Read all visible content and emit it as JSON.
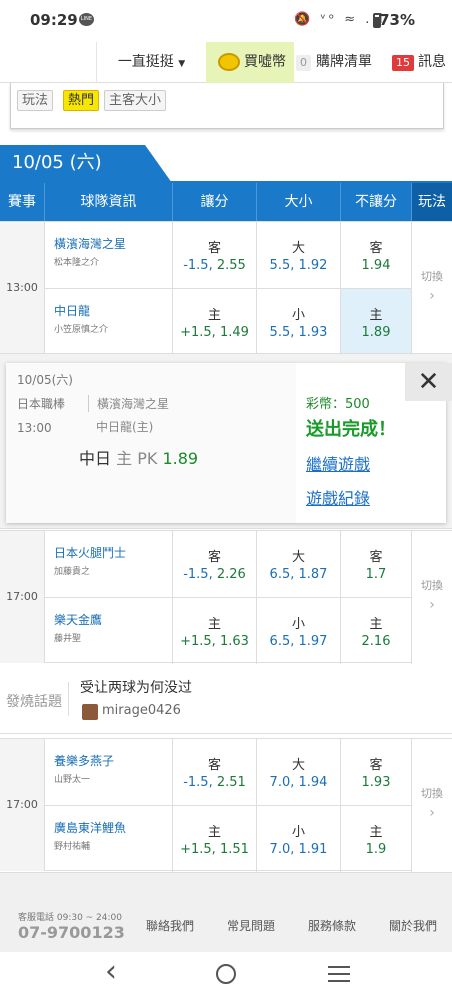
{
  "status": {
    "time": "09:29",
    "battery": "73%",
    "icons": "🔕 ᵛᵒ ≈ .ıl"
  },
  "nav": {
    "dropdown": "一直挺挺",
    "buy": "買噓幣",
    "cart_count": "0",
    "cart": "購牌清單",
    "msg_count": "15",
    "msg": "訊息"
  },
  "filter": {
    "tags": [
      "玩法",
      "熱門",
      "主客大小"
    ]
  },
  "date": "10/05 (六)",
  "header": {
    "event": "賽事",
    "team": "球隊資訊",
    "spread": "讓分",
    "ou": "大小",
    "ml": "不讓分",
    "play": "玩法"
  },
  "labels": {
    "away": "客",
    "home": "主",
    "over": "大",
    "under": "小",
    "switch": "切換",
    "chev": "›"
  },
  "matches": [
    {
      "time": "13:00",
      "away": {
        "name": "橫濱海灣之星",
        "pitcher": "松本隆之介",
        "spread": "-1.5,",
        "spread_odds": "2.55",
        "ou": "5.5,",
        "ou_odds": "1.92",
        "ml": "1.94"
      },
      "home": {
        "name": "中日龍",
        "pitcher": "小笠原慎之介",
        "spread": "+1.5,",
        "spread_odds": "1.49",
        "ou": "5.5,",
        "ou_odds": "1.93",
        "ml": "1.89"
      }
    },
    {
      "time": "17:00",
      "away": {
        "name": "日本火腿鬥士",
        "pitcher": "加藤貴之",
        "spread": "-1.5,",
        "spread_odds": "2.26",
        "ou": "6.5,",
        "ou_odds": "1.87",
        "ml": "1.7"
      },
      "home": {
        "name": "樂天金鷹",
        "pitcher": "藤井聖",
        "spread": "+1.5,",
        "spread_odds": "1.63",
        "ou": "6.5,",
        "ou_odds": "1.97",
        "ml": "2.16"
      }
    },
    {
      "time": "17:00",
      "away": {
        "name": "養樂多燕子",
        "pitcher": "山野太一",
        "spread": "-1.5,",
        "spread_odds": "2.51",
        "ou": "7.0,",
        "ou_odds": "1.94",
        "ml": "1.93"
      },
      "home": {
        "name": "廣島東洋鯉魚",
        "pitcher": "野村祐輔",
        "spread": "+1.5,",
        "spread_odds": "1.51",
        "ou": "7.0,",
        "ou_odds": "1.91",
        "ml": "1.9"
      }
    }
  ],
  "popup": {
    "date": "10/05(六)",
    "league": "日本職棒",
    "time": "13:00",
    "team1": "橫濱海灣之星",
    "team2": "中日龍(主)",
    "bet_team": "中日",
    "bet_side": "主",
    "bet_type": "PK",
    "bet_odds": "1.89",
    "coins": "彩幣：500",
    "done": "送出完成！",
    "continue": "繼續遊戲",
    "history": "遊戲紀錄",
    "close": "✕"
  },
  "topic": {
    "label": "發燒話題",
    "title": "受让两球为何没过",
    "user": "mirage0426"
  },
  "footer": {
    "hotline": "客服電話 09:30 ~ 24:00",
    "phone": "07-9700123",
    "links": [
      "聯絡我們",
      "常見問題",
      "服務條款",
      "關於我們"
    ]
  },
  "android": {
    "back": "‹"
  }
}
